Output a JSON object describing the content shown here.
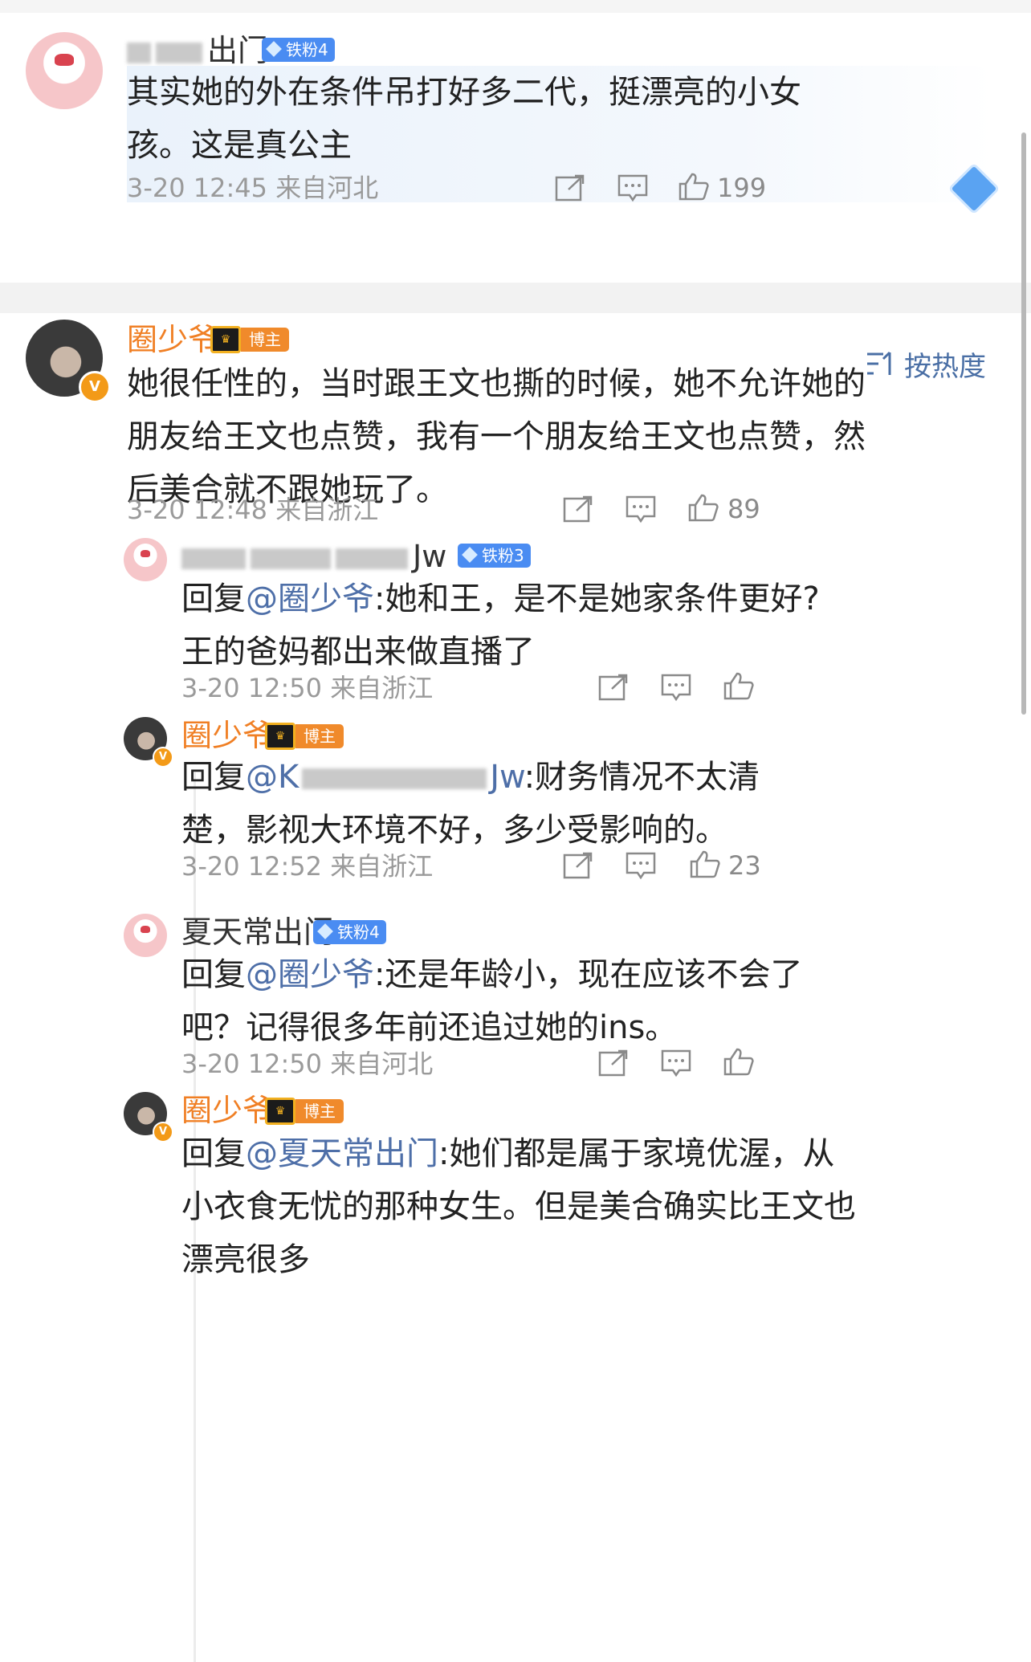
{
  "top_comment": {
    "username_visible": "出门",
    "fan_badge": "铁粉4",
    "text_lines": [
      "其实她的外在条件吊打好多二代，挺漂亮的小女",
      "孩。这是真公主"
    ],
    "time": "3-20 12:45",
    "location": "来自河北",
    "likes": "199"
  },
  "sort": {
    "label": "按热度"
  },
  "main_comment": {
    "username": "圈少爷",
    "host_badge": "博主",
    "verified_badge": "V",
    "text_lines": [
      "她很任性的，当时跟王文也撕的时候，她不允许她的",
      "朋友给王文也点赞，我有一个朋友给王文也点赞，然",
      "后美合就不跟她玩了。"
    ],
    "time": "3-20 12:48",
    "location": "来自浙江",
    "likes": "89"
  },
  "replies": [
    {
      "username_visible": "Jw",
      "fan_badge": "铁粉3",
      "reply_prefix": "回复",
      "mention": "@圈少爷",
      "text_lines": [
        ":她和王，是不是她家条件更好?",
        "王的爸妈都出来做直播了"
      ],
      "time": "3-20 12:50",
      "location": "来自浙江",
      "likes": ""
    },
    {
      "username": "圈少爷",
      "host_badge": "博主",
      "reply_prefix": "回复",
      "mention_visible_start": "@K",
      "mention_visible_end": "Jw",
      "text_lines": [
        ":财务情况不太清",
        "楚，影视大环境不好，多少受影响的。"
      ],
      "time": "3-20 12:52",
      "location": "来自浙江",
      "likes": "23"
    },
    {
      "username_visible": "夏天常出门",
      "fan_badge": "铁粉4",
      "reply_prefix": "回复",
      "mention": "@圈少爷",
      "text_lines": [
        ":还是年龄小，现在应该不会了",
        "吧？记得很多年前还追过她的ins。"
      ],
      "time": "3-20 12:50",
      "location": "来自河北",
      "likes": ""
    },
    {
      "username": "圈少爷",
      "host_badge": "博主",
      "reply_prefix": "回复",
      "mention_visible": "@夏天常出门",
      "text_lines": [
        ":她们都是属于家境优渥，从",
        "小衣食无忧的那种女生。但是美合确实比王文也",
        "漂亮很多"
      ],
      "time": "",
      "location": "",
      "likes": ""
    }
  ],
  "colors": {
    "accent_blue": "#4e6fa8",
    "username_orange": "#f07f24",
    "fan_badge_blue": "#4a8cf2",
    "host_badge_orange": "#f08a2b",
    "meta_gray": "#9a9a9a"
  },
  "icons": [
    "share-icon",
    "comment-icon",
    "like-icon",
    "sort-icon",
    "diamond-sticker-icon"
  ]
}
